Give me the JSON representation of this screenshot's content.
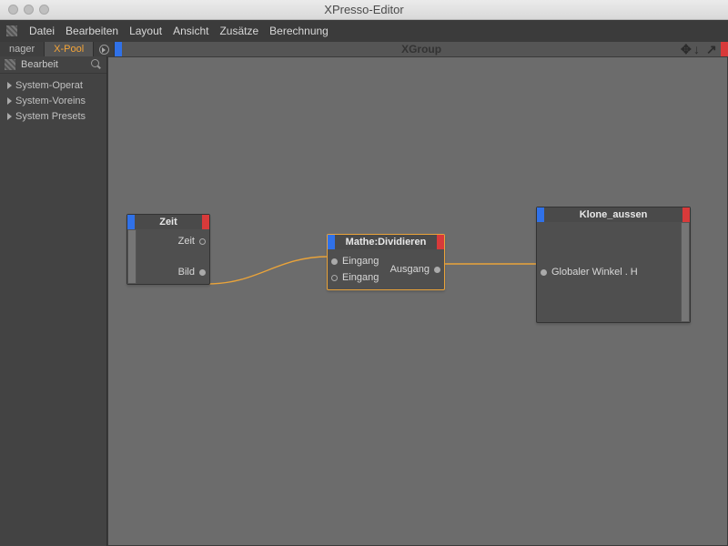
{
  "window": {
    "title": "XPresso-Editor"
  },
  "menu": {
    "items": [
      "Datei",
      "Bearbeiten",
      "Layout",
      "Ansicht",
      "Zusätze",
      "Berechnung"
    ]
  },
  "tabs": {
    "left": "nager",
    "active": "X-Pool"
  },
  "group": {
    "title": "XGroup"
  },
  "sidebar": {
    "header": "Bearbeit",
    "items": [
      "System-Operat",
      "System-Voreins",
      "System Presets"
    ]
  },
  "nodes": {
    "zeit": {
      "title": "Zeit",
      "outputs": [
        "Zeit",
        "Bild"
      ]
    },
    "mathe": {
      "title": "Mathe:Dividieren",
      "inputs": [
        "Eingang",
        "Eingang"
      ],
      "outputs": [
        "Ausgang"
      ]
    },
    "klone": {
      "title": "Klone_aussen",
      "inputs": [
        "Globaler Winkel . H"
      ]
    }
  }
}
